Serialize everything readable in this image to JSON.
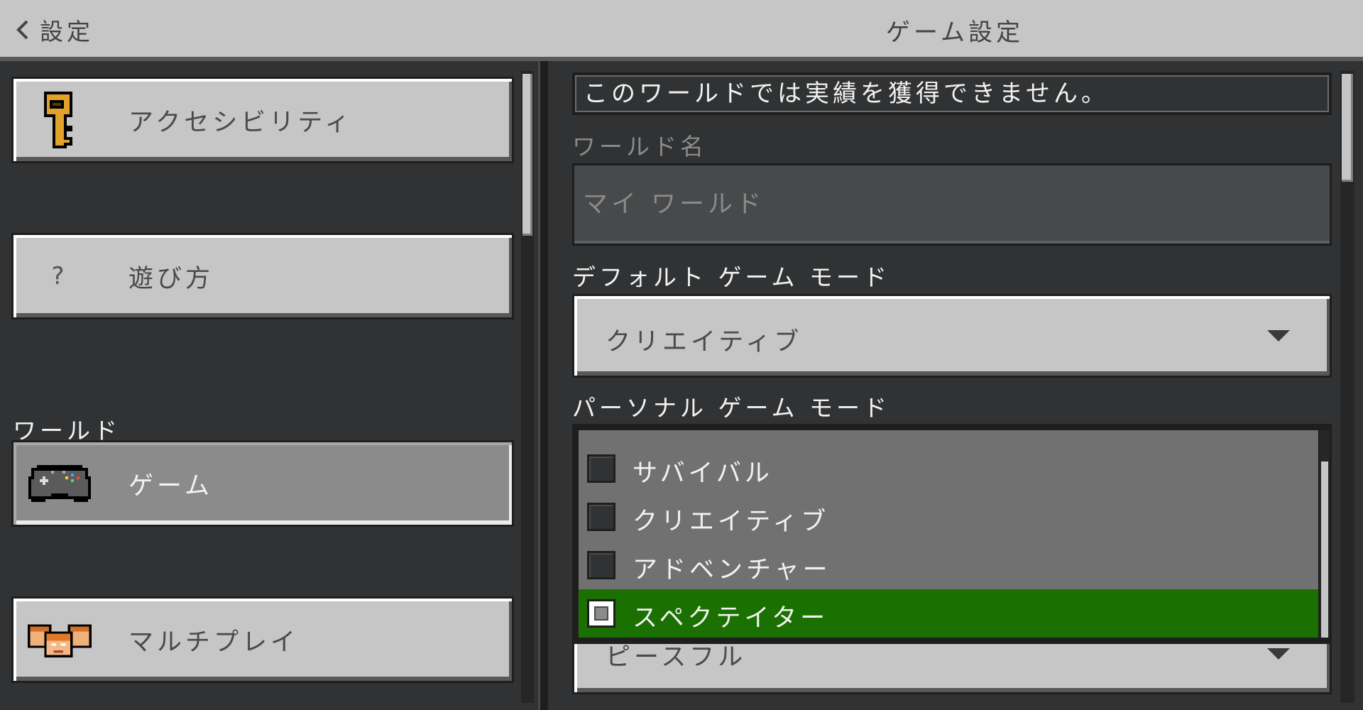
{
  "topbar": {
    "back_label": "設定",
    "title": "ゲーム設定"
  },
  "sidebar": {
    "items": [
      {
        "label": "アクセシビリティ",
        "icon": "key-icon"
      },
      {
        "label": "遊び方",
        "icon": "question-icon",
        "glyph": "?"
      },
      {
        "label": "ゲーム",
        "icon": "controller-icon",
        "active": true
      },
      {
        "label": "マルチプレイ",
        "icon": "players-icon"
      }
    ],
    "section_world": "ワールド"
  },
  "main": {
    "notice": "このワールドでは実績を獲得できません。",
    "world_name": {
      "label": "ワールド名",
      "placeholder": "マイ ワールド"
    },
    "default_game_mode": {
      "label": "デフォルト ゲーム モード",
      "value": "クリエイティブ"
    },
    "personal_game_mode": {
      "label": "パーソナル ゲーム モード",
      "options": [
        "サバイバル",
        "クリエイティブ",
        "アドベンチャー",
        "スペクテイター"
      ],
      "selected": "スペクテイター"
    },
    "difficulty": {
      "value": "ピースフル"
    }
  },
  "colors": {
    "selected_green": "#1a7000",
    "panel_bg": "#313233",
    "button_gray": "#c6c6c6"
  }
}
